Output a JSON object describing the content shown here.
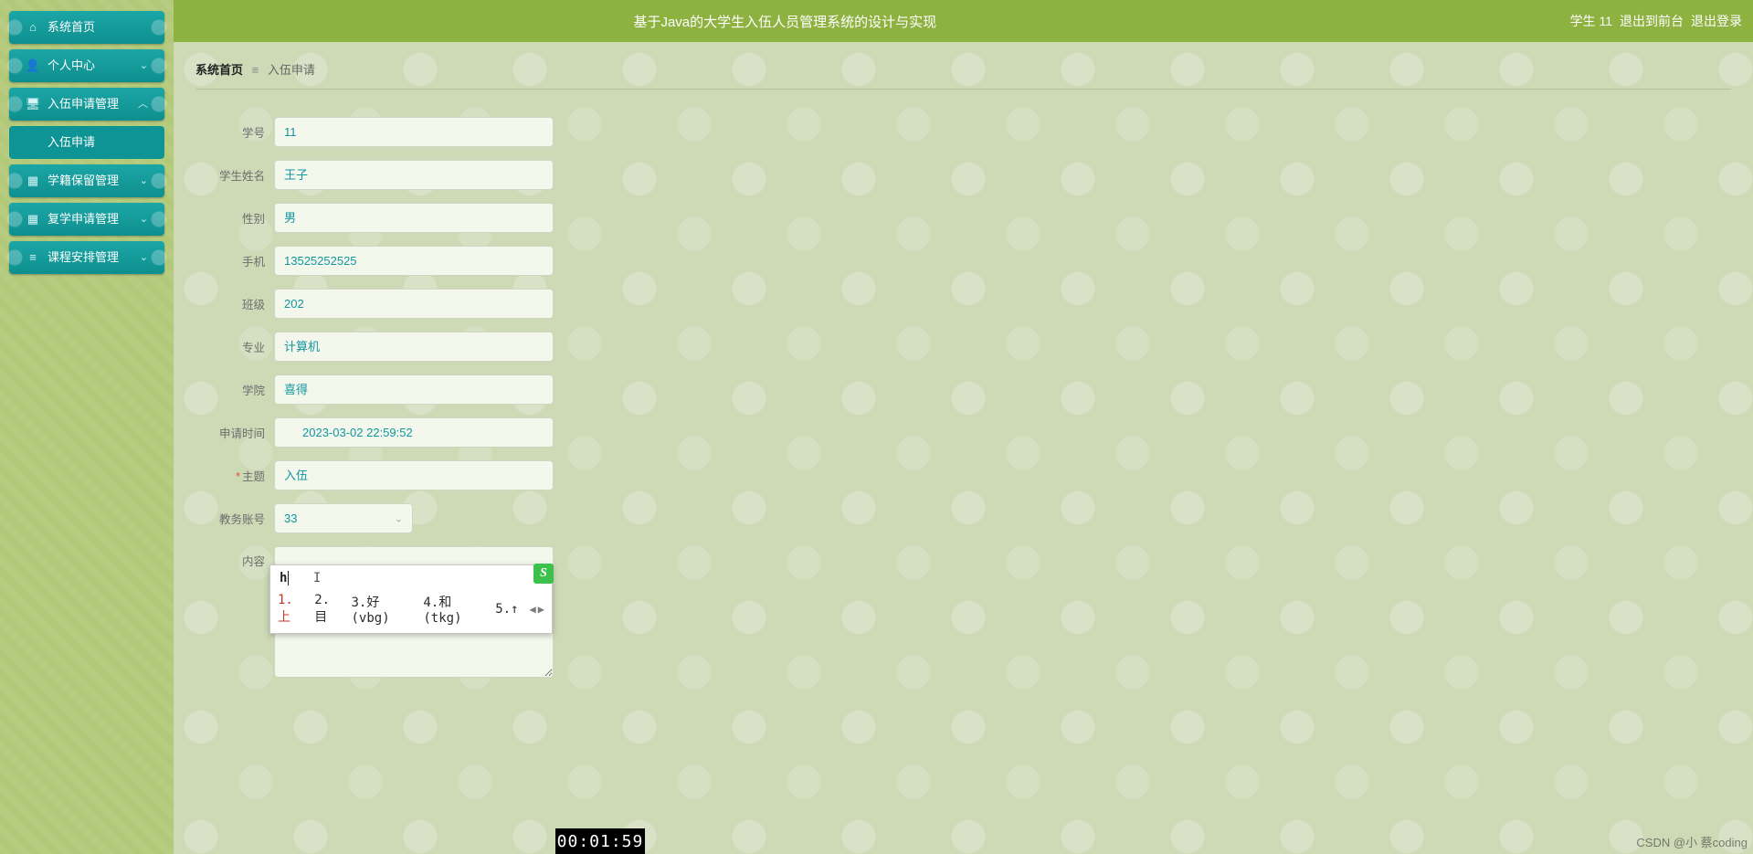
{
  "header": {
    "title": "基于Java的大学生入伍人员管理系统的设计与实现",
    "user": "学生 11",
    "link_front": "退出到前台",
    "link_logout": "退出登录"
  },
  "sidebar": {
    "items": [
      {
        "icon": "home",
        "label": "系统首页",
        "expandable": false
      },
      {
        "icon": "user",
        "label": "个人中心",
        "expandable": true
      },
      {
        "icon": "pc",
        "label": "入伍申请管理",
        "expandable": true,
        "sub": [
          {
            "label": "入伍申请"
          }
        ]
      },
      {
        "icon": "grid",
        "label": "学籍保留管理",
        "expandable": true
      },
      {
        "icon": "grid",
        "label": "复学申请管理",
        "expandable": true
      },
      {
        "icon": "list",
        "label": "课程安排管理",
        "expandable": true
      }
    ]
  },
  "breadcrumb": {
    "home": "系统首页",
    "current": "入伍申请"
  },
  "form": {
    "student_id": {
      "label": "学号",
      "value": "11"
    },
    "student_name": {
      "label": "学生姓名",
      "value": "王子"
    },
    "gender": {
      "label": "性别",
      "value": "男"
    },
    "phone": {
      "label": "手机",
      "value": "13525252525"
    },
    "class": {
      "label": "班级",
      "value": "202"
    },
    "major": {
      "label": "专业",
      "value": "计算机"
    },
    "college": {
      "label": "学院",
      "value": "喜得"
    },
    "apply_time": {
      "label": "申请时间",
      "value": "2023-03-02 22:59:52"
    },
    "subject": {
      "label": "主题",
      "value": "入伍",
      "required": true
    },
    "admin_acct": {
      "label": "教务账号",
      "value": "33"
    },
    "content": {
      "label": "内容",
      "value": ""
    }
  },
  "ime": {
    "input": "h",
    "candidates": [
      "1.上",
      "2.目",
      "3.好(vbg)",
      "4.和(tkg)",
      "5.↑"
    ]
  },
  "timer": "00:01:59",
  "watermark": "CSDN @小 蔡coding"
}
